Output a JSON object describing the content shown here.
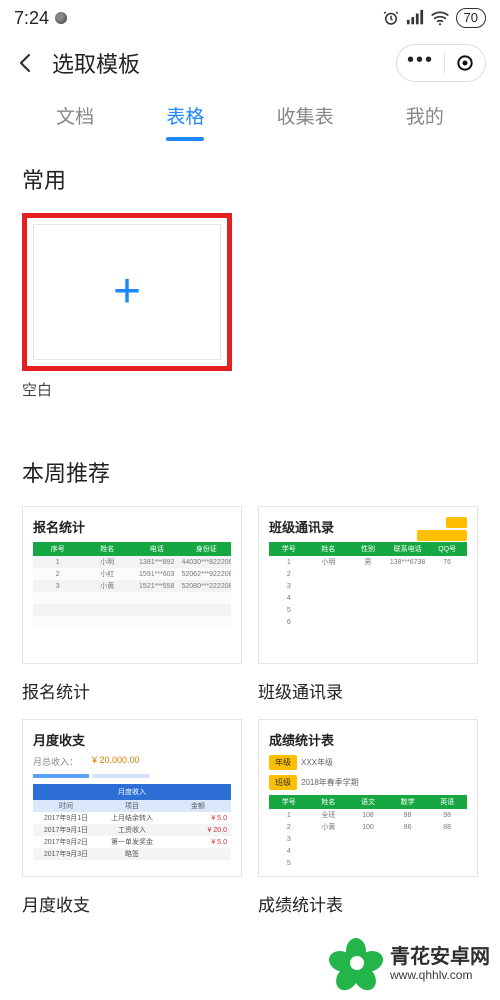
{
  "status": {
    "time": "7:24",
    "battery": "70"
  },
  "header": {
    "title": "选取模板"
  },
  "tabs": [
    {
      "label": "文档",
      "active": false
    },
    {
      "label": "表格",
      "active": true
    },
    {
      "label": "收集表",
      "active": false
    },
    {
      "label": "我的",
      "active": false
    }
  ],
  "section_frequent": {
    "title": "常用",
    "blank_label": "空白"
  },
  "section_recommend": {
    "title": "本周推荐",
    "templates": [
      {
        "name": "报名统计",
        "thumb_title": "报名统计",
        "table_headers": [
          "序号",
          "姓名",
          "电话",
          "身份证"
        ],
        "rows": [
          [
            "1",
            "小明",
            "1381***892",
            "44030***822206"
          ],
          [
            "2",
            "小红",
            "1591***603",
            "52062***922208"
          ],
          [
            "3",
            "小黄",
            "1521***558",
            "52080***222208"
          ]
        ]
      },
      {
        "name": "班级通讯录",
        "thumb_title": "班级通讯录",
        "table_headers": [
          "学号",
          "姓名",
          "性别",
          "联系电话",
          "QQ号"
        ],
        "rows": [
          [
            "1",
            "小明",
            "男",
            "138***6738",
            "76"
          ],
          [
            "2",
            "",
            "",
            "",
            ""
          ],
          [
            "3",
            "",
            "",
            "",
            ""
          ],
          [
            "4",
            "",
            "",
            "",
            ""
          ],
          [
            "5",
            "",
            "",
            "",
            ""
          ],
          [
            "6",
            "",
            "",
            "",
            ""
          ]
        ]
      },
      {
        "name": "月度收支",
        "thumb_title": "月度收支",
        "caption": "月度收入",
        "sub_left": "月总收入：",
        "sub_right": "¥ 20,000.00",
        "table_headers": [
          "时间",
          "项目",
          "金额"
        ],
        "rows": [
          [
            "2017年9月1日",
            "上月结余转入",
            "¥ 5.0"
          ],
          [
            "2017年9月1日",
            "工资收入",
            "¥ 20.0"
          ],
          [
            "2017年9月2日",
            "第一单发奖金",
            "¥ 5.0"
          ],
          [
            "2017年9月3日",
            "略签",
            ""
          ]
        ]
      },
      {
        "name": "成绩统计表",
        "thumb_title": "成绩统计表",
        "badge1": "年级",
        "badge1_val": "XXX年级",
        "badge2": "班级",
        "badge2_val": "2018年春季学期",
        "table_headers": [
          "学号",
          "姓名",
          "语文",
          "数学",
          "英语"
        ],
        "rows": [
          [
            "1",
            "全班",
            "108",
            "98",
            "98"
          ],
          [
            "2",
            "小黄",
            "100",
            "96",
            "88"
          ],
          [
            "3",
            "",
            "",
            "",
            ""
          ],
          [
            "4",
            "",
            "",
            "",
            ""
          ],
          [
            "5",
            "",
            "",
            "",
            ""
          ]
        ]
      }
    ]
  },
  "watermark": {
    "name": "青花安卓网",
    "url": "www.qhhlv.com"
  }
}
